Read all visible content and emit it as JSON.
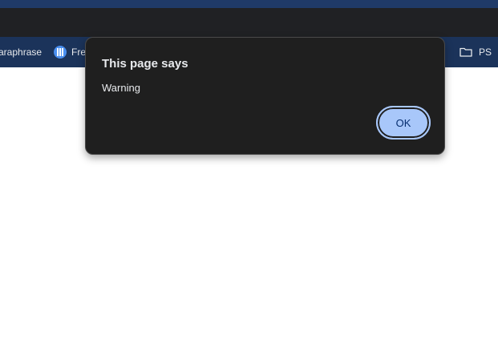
{
  "bookmarks_bar": {
    "items": [
      {
        "label": "araphrase",
        "icon": "none"
      },
      {
        "label": "Fre",
        "icon": "blue-circle-icon"
      },
      {
        "label": "PS",
        "icon": "folder-icon"
      }
    ]
  },
  "dialog": {
    "title": "This page says",
    "message": "Warning",
    "ok_label": "OK"
  },
  "colors": {
    "tab_strip": "#202124",
    "bookmarks_bar": "#1b335a",
    "dialog_bg": "#1f1f1f",
    "ok_button": "#a8c7fa",
    "ok_text": "#062e6f"
  }
}
